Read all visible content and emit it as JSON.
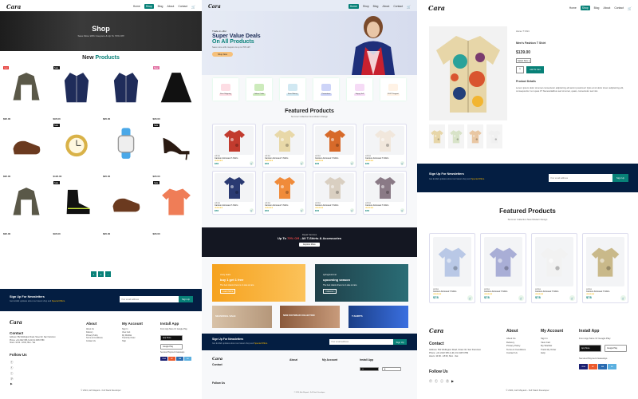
{
  "brand": "Cara",
  "colors": {
    "accent": "#088178",
    "dark": "#041e42",
    "banner": "#141722"
  },
  "p1": {
    "nav": [
      "Home",
      "Shop",
      "Blog",
      "About",
      "Contact"
    ],
    "active": "Shop",
    "hero_title": "Shop",
    "hero_sub": "Save More With Coupons & Up To 70% Off!",
    "new_a": "New ",
    "new_b": "Products",
    "products": [
      {
        "icon": "jacket-icon",
        "price": "$95.00",
        "badge": "Hot"
      },
      {
        "icon": "coat-icon",
        "price": "$95.00",
        "badge": "Sale"
      },
      {
        "icon": "coat-icon",
        "price": "$95.00",
        "badge": ""
      },
      {
        "icon": "cape-icon",
        "price": "$95.00",
        "badge": "New"
      },
      {
        "icon": "shoe-icon",
        "price": "$95.00",
        "badge": ""
      },
      {
        "icon": "watch-icon",
        "price": "$120.00",
        "badge": "Sale"
      },
      {
        "icon": "smartwatch-icon",
        "price": "$95.00",
        "badge": ""
      },
      {
        "icon": "heel-icon",
        "price": "$95.00",
        "badge": "Sale"
      },
      {
        "icon": "jacket-icon",
        "price": "$95.00",
        "badge": ""
      },
      {
        "icon": "boot-icon",
        "price": "$95.00",
        "badge": "Sale"
      },
      {
        "icon": "shoe-icon",
        "price": "$95.00",
        "badge": ""
      },
      {
        "icon": "tshirt-icon",
        "price": "$95.00",
        "badge": "Sale"
      }
    ],
    "pages": [
      "1",
      "2",
      "→"
    ],
    "newsletter": {
      "title": "Sign Up For Newsletters",
      "sub": "Get E-Mail updates about our latest shop and ",
      "sub_hl": "Special Offers.",
      "placeholder": "Your email address",
      "button": "Sign Up"
    },
    "footer": {
      "contact_h": "Contact",
      "contact": "Address: 562 Wellington Road, Street 32, San Francisco\nPhone: +01 2222 365 /(+91) 01 2345 6789\nHours: 10:00 - 18:00, Mon - Sat",
      "follow_h": "Follow Us",
      "about_h": "About",
      "about": "About Us\nDelivery\nPrivacy Policy\nTerms & Conditions\nContact Us",
      "account_h": "My Account",
      "account": "Sign In\nView Cart\nMy Wishlist\nTrack My Order\nHelp",
      "app_h": "Install App",
      "app_sub": "From App Store Or Google Play",
      "appstore": "App Store",
      "googleplay": "Google Play",
      "secured": "Secured Payment Gateways",
      "copy": "© 2024, Ash Mayank - Full Stack Developer"
    }
  },
  "p2": {
    "nav": [
      "Home",
      "Shop",
      "Blog",
      "About",
      "Contact"
    ],
    "active": "Home",
    "hero_a": "Trade-in-offer",
    "hero_b": "Super Value Deals",
    "hero_c": "On All Products",
    "hero_d": "Save more with coupons & up to 70% off!",
    "hero_btn": "Shop Now",
    "features": [
      {
        "label": "Free Shipping",
        "color": "#fddde4"
      },
      {
        "label": "Online Order",
        "color": "#cdebbc"
      },
      {
        "label": "Save Money",
        "color": "#d1e8f2"
      },
      {
        "label": "Promotions",
        "color": "#cdd4f8"
      },
      {
        "label": "Happy Sell",
        "color": "#f6dbf6"
      },
      {
        "label": "F24/7 Support",
        "color": "#fff2e5"
      }
    ],
    "featured_title": "Featured Products",
    "featured_sub": "Summer Collection New Modern Design",
    "cards": [
      {
        "brand": "adidas",
        "name": "Cartoon Astronaut T-Shirts",
        "price": "$78"
      },
      {
        "brand": "adidas",
        "name": "Cartoon Astronaut T-Shirts",
        "price": "$78"
      },
      {
        "brand": "adidas",
        "name": "Cartoon Astronaut T-Shirts",
        "price": "$78"
      },
      {
        "brand": "adidas",
        "name": "Cartoon Astronaut T-Shirts",
        "price": "$78"
      },
      {
        "brand": "adidas",
        "name": "Cartoon Astronaut T-Shirts",
        "price": "$78"
      },
      {
        "brand": "adidas",
        "name": "Cartoon Astronaut T-Shirts",
        "price": "$78"
      },
      {
        "brand": "adidas",
        "name": "Cartoon Astronaut T-Shirts",
        "price": "$78"
      },
      {
        "brand": "adidas",
        "name": "Cartoon Astronaut T-Shirts",
        "price": "$78"
      }
    ],
    "stars": "★★★★★",
    "banner_a": "Repair Services",
    "banner_b": "Up To ",
    "banner_hl": "70% Off",
    "banner_c": " - All T-Shirts & Accessories",
    "banner_btn": "Explore More",
    "promo1": {
      "a": "crazy deals",
      "b": "buy 1 get 1 free",
      "c": "The best classic dress is on sale at cara",
      "d": "Learn More"
    },
    "promo2": {
      "a": "spring/summer",
      "b": "upcoming season",
      "c": "The best classic dress is on sale at cara",
      "d": "Collection"
    },
    "promo3": "SEASONAL SALE",
    "promo4": "NEW FOOTWEAR COLLECTION",
    "promo5": "T-SHIRTS",
    "newsletter": {
      "title": "Sign Up For Newsletters",
      "sub": "Get E-Mail updates about our latest shop and ",
      "sub_hl": "Special Offers.",
      "placeholder": "Your email address",
      "button": "Sign Up"
    },
    "footer": {
      "contact_h": "Contact",
      "about_h": "About",
      "account_h": "My Account",
      "app_h": "Install App",
      "follow_h": "Follow Us",
      "copy": "© 2024, Ash Mayank - Full Stack Developer"
    }
  },
  "p3": {
    "nav": [
      "Home",
      "Shop",
      "Blog",
      "About",
      "Contact"
    ],
    "active": "Shop",
    "crumb": "Home / T-Shirt",
    "title": "Men's Fashion T Shirt",
    "price": "$139.00",
    "select": "Select Size",
    "qty": "1",
    "add": "Add To Cart",
    "details_h": "Product Details",
    "details": "Lorem ipsum dolor sit amet consectetur adipisicing elit animi possimus! Quis at sit dolor lorem adipisicing elit, consequuntur non quas it? Necessitatibus sed sit amet, quasi, consectetur sed nisi.",
    "newsletter": {
      "title": "Sign Up For Newsletters",
      "sub": "Get E-Mail updates about our latest shop and ",
      "sub_hl": "Special Offers.",
      "placeholder": "Your email address",
      "button": "Sign Up"
    },
    "featured_title": "Featured Products",
    "featured_sub": "Summer Collection New Modern Design",
    "cards": [
      {
        "brand": "adidas",
        "name": "Cartoon Astronaut T-Shirts",
        "price": "$78"
      },
      {
        "brand": "adidas",
        "name": "Cartoon Astronaut T-Shirts",
        "price": "$78"
      },
      {
        "brand": "adidas",
        "name": "Cartoon Astronaut T-Shirts",
        "price": "$78"
      },
      {
        "brand": "adidas",
        "name": "Cartoon Astronaut T-Shirts",
        "price": "$78"
      }
    ],
    "footer": {
      "contact_h": "Contact",
      "contact": "Address: 562 Wellington Road, Street 32, San Francisco\nPhone: +01 2222 365 /(+91) 01 2345 6789\nHours: 10:00 - 18:00, Mon - Sat",
      "follow_h": "Follow Us",
      "about_h": "About",
      "about": "About Us\nDelivery\nPrivacy Policy\nTerms & Conditions\nContact Us",
      "account_h": "My Account",
      "account": "Sign In\nView Cart\nMy Wishlist\nTrack My Order\nHelp",
      "app_h": "Install App",
      "app_sub": "From App Store Or Google Play",
      "appstore": "App Store",
      "googleplay": "Google Play",
      "secured": "Secured Payment Gateways",
      "copy": "© 2024, Ash Mayank - Full Stack Developer"
    }
  }
}
